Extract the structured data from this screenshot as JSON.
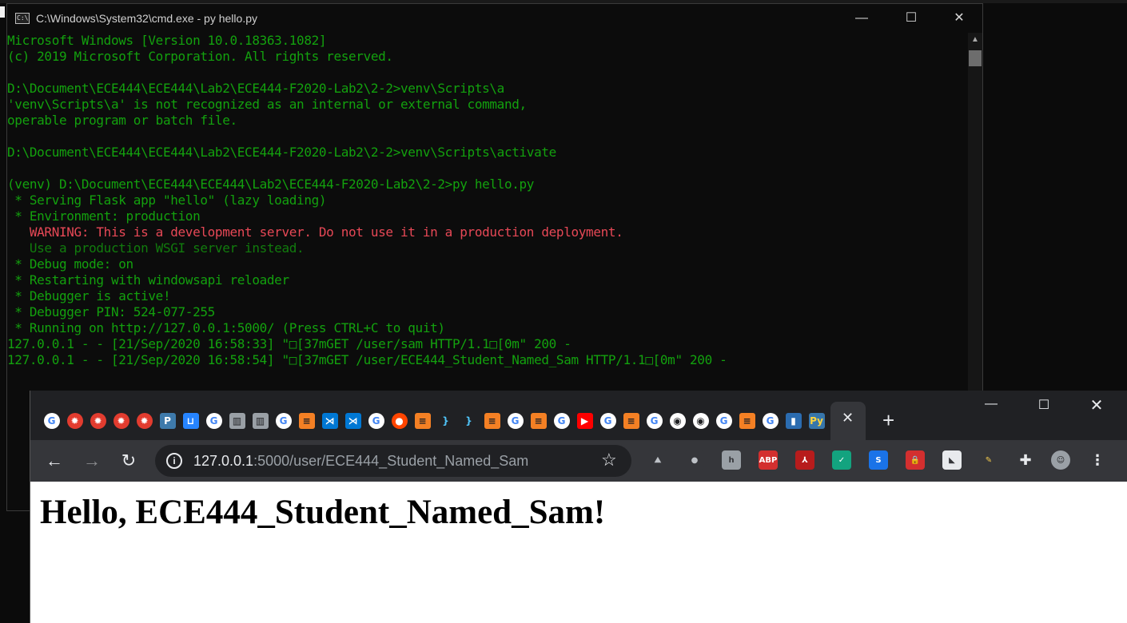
{
  "cmd": {
    "title": "C:\\Windows\\System32\\cmd.exe - py  hello.py",
    "icon_label": "C:\\",
    "lines": [
      {
        "text": "Microsoft Windows [Version 10.0.18363.1082]",
        "style": "normal"
      },
      {
        "text": "(c) 2019 Microsoft Corporation. All rights reserved.",
        "style": "normal"
      },
      {
        "text": "",
        "style": "normal"
      },
      {
        "text": "D:\\Document\\ECE444\\ECE444\\Lab2\\ECE444-F2020-Lab2\\2-2>venv\\Scripts\\a",
        "style": "normal"
      },
      {
        "text": "'venv\\Scripts\\a' is not recognized as an internal or external command,",
        "style": "normal"
      },
      {
        "text": "operable program or batch file.",
        "style": "normal"
      },
      {
        "text": "",
        "style": "normal"
      },
      {
        "text": "D:\\Document\\ECE444\\ECE444\\Lab2\\ECE444-F2020-Lab2\\2-2>venv\\Scripts\\activate",
        "style": "normal"
      },
      {
        "text": "",
        "style": "normal"
      },
      {
        "text": "(venv) D:\\Document\\ECE444\\ECE444\\Lab2\\ECE444-F2020-Lab2\\2-2>py hello.py",
        "style": "normal"
      },
      {
        "text": " * Serving Flask app \"hello\" (lazy loading)",
        "style": "normal"
      },
      {
        "text": " * Environment: production",
        "style": "normal"
      },
      {
        "text": "   WARNING: This is a development server. Do not use it in a production deployment.",
        "style": "warn"
      },
      {
        "text": "   Use a production WSGI server instead.",
        "style": "dim"
      },
      {
        "text": " * Debug mode: on",
        "style": "normal"
      },
      {
        "text": " * Restarting with windowsapi reloader",
        "style": "normal"
      },
      {
        "text": " * Debugger is active!",
        "style": "normal"
      },
      {
        "text": " * Debugger PIN: 524-077-255",
        "style": "normal"
      },
      {
        "text": " * Running on http://127.0.0.1:5000/ (Press CTRL+C to quit)",
        "style": "normal"
      },
      {
        "text": "127.0.0.1 - - [21/Sep/2020 16:58:33] \"□[37mGET /user/sam HTTP/1.1□[0m\" 200 -",
        "style": "normal"
      },
      {
        "text": "127.0.0.1 - - [21/Sep/2020 16:58:54] \"□[37mGET /user/ECE444_Student_Named_Sam HTTP/1.1□[0m\" 200 -",
        "style": "normal"
      }
    ],
    "controls": {
      "minimize": "—",
      "maximize": "☐",
      "close": "✕"
    }
  },
  "chrome": {
    "pinned_tabs": [
      {
        "name": "google",
        "glyph": "G",
        "color": "#ffffff",
        "fg": "#4285f4",
        "shape": "circle"
      },
      {
        "name": "canvas",
        "glyph": "✹",
        "color": "#e23c2f",
        "fg": "#ffffff",
        "shape": "circle"
      },
      {
        "name": "canvas",
        "glyph": "✹",
        "color": "#e23c2f",
        "fg": "#ffffff",
        "shape": "circle"
      },
      {
        "name": "canvas",
        "glyph": "✹",
        "color": "#e23c2f",
        "fg": "#ffffff",
        "shape": "circle"
      },
      {
        "name": "canvas",
        "glyph": "✹",
        "color": "#e23c2f",
        "fg": "#ffffff",
        "shape": "circle"
      },
      {
        "name": "piazza",
        "glyph": "P",
        "color": "#3e7aab",
        "fg": "#ffffff",
        "shape": "square"
      },
      {
        "name": "bitbucket",
        "glyph": "⊔",
        "color": "#2684ff",
        "fg": "#ffffff",
        "shape": "square"
      },
      {
        "name": "google",
        "glyph": "G",
        "color": "#ffffff",
        "fg": "#4285f4",
        "shape": "circle"
      },
      {
        "name": "docs",
        "glyph": "▥",
        "color": "#9aa0a6",
        "fg": "#202124",
        "shape": "square"
      },
      {
        "name": "docs",
        "glyph": "▥",
        "color": "#9aa0a6",
        "fg": "#202124",
        "shape": "square"
      },
      {
        "name": "google",
        "glyph": "G",
        "color": "#ffffff",
        "fg": "#4285f4",
        "shape": "circle"
      },
      {
        "name": "stackoverflow",
        "glyph": "≡",
        "color": "#f48024",
        "fg": "#202124",
        "shape": "square"
      },
      {
        "name": "vscode",
        "glyph": "⋊",
        "color": "#0078d4",
        "fg": "#ffffff",
        "shape": "square"
      },
      {
        "name": "vscode",
        "glyph": "⋊",
        "color": "#0078d4",
        "fg": "#ffffff",
        "shape": "square"
      },
      {
        "name": "google",
        "glyph": "G",
        "color": "#ffffff",
        "fg": "#4285f4",
        "shape": "circle"
      },
      {
        "name": "reddit",
        "glyph": "●",
        "color": "#ff4500",
        "fg": "#ffffff",
        "shape": "circle"
      },
      {
        "name": "stackoverflow",
        "glyph": "≡",
        "color": "#f48024",
        "fg": "#202124",
        "shape": "square"
      },
      {
        "name": "json",
        "glyph": "}",
        "color": "#202124",
        "fg": "#4fc3f7",
        "shape": "square"
      },
      {
        "name": "json",
        "glyph": "}",
        "color": "#202124",
        "fg": "#4fc3f7",
        "shape": "square"
      },
      {
        "name": "stackoverflow",
        "glyph": "≡",
        "color": "#f48024",
        "fg": "#202124",
        "shape": "square"
      },
      {
        "name": "google",
        "glyph": "G",
        "color": "#ffffff",
        "fg": "#4285f4",
        "shape": "circle"
      },
      {
        "name": "stackoverflow",
        "glyph": "≡",
        "color": "#f48024",
        "fg": "#202124",
        "shape": "square"
      },
      {
        "name": "google",
        "glyph": "G",
        "color": "#ffffff",
        "fg": "#4285f4",
        "shape": "circle"
      },
      {
        "name": "youtube",
        "glyph": "▶",
        "color": "#ff0000",
        "fg": "#ffffff",
        "shape": "square"
      },
      {
        "name": "google",
        "glyph": "G",
        "color": "#ffffff",
        "fg": "#4285f4",
        "shape": "circle"
      },
      {
        "name": "stackoverflow",
        "glyph": "≡",
        "color": "#f48024",
        "fg": "#202124",
        "shape": "square"
      },
      {
        "name": "google",
        "glyph": "G",
        "color": "#ffffff",
        "fg": "#4285f4",
        "shape": "circle"
      },
      {
        "name": "github",
        "glyph": "◉",
        "color": "#ffffff",
        "fg": "#202124",
        "shape": "circle"
      },
      {
        "name": "github",
        "glyph": "◉",
        "color": "#ffffff",
        "fg": "#202124",
        "shape": "circle"
      },
      {
        "name": "google",
        "glyph": "G",
        "color": "#ffffff",
        "fg": "#4285f4",
        "shape": "circle"
      },
      {
        "name": "stackoverflow",
        "glyph": "≡",
        "color": "#f48024",
        "fg": "#202124",
        "shape": "square"
      },
      {
        "name": "google",
        "glyph": "G",
        "color": "#ffffff",
        "fg": "#4285f4",
        "shape": "circle"
      },
      {
        "name": "flask-docs",
        "glyph": "▮",
        "color": "#2b6cb0",
        "fg": "#ffffff",
        "shape": "square"
      },
      {
        "name": "python",
        "glyph": "Py",
        "color": "#3776ab",
        "fg": "#ffd43b",
        "shape": "square"
      }
    ],
    "active_tab_close": "✕",
    "new_tab": "+",
    "window_controls": {
      "minimize": "—",
      "maximize": "☐",
      "close": "✕"
    },
    "nav": {
      "back": "←",
      "forward": "→",
      "reload": "↻"
    },
    "info_icon": "i",
    "url_host": "127.0.0.1",
    "url_path": ":5000/user/ECE444_Student_Named_Sam",
    "star": "☆",
    "extensions": [
      {
        "name": "nord-icon",
        "glyph": "⛰",
        "bg": "#35363a",
        "fg": "#bdc1c6"
      },
      {
        "name": "speech-icon",
        "glyph": "●",
        "bg": "#35363a",
        "fg": "#bdc1c6"
      },
      {
        "name": "hypothesis-icon",
        "glyph": "h",
        "bg": "#9aa0a6",
        "fg": "#35363a"
      },
      {
        "name": "abp-icon",
        "glyph": "ABP",
        "bg": "#d32f2f",
        "fg": "#ffffff"
      },
      {
        "name": "pdf-icon",
        "glyph": "⅄",
        "bg": "#b71c1c",
        "fg": "#ffffff"
      },
      {
        "name": "shield-check-icon",
        "glyph": "✓",
        "bg": "#13a37f",
        "fg": "#ffffff"
      },
      {
        "name": "s-icon",
        "glyph": "S",
        "bg": "#1a73e8",
        "fg": "#ffffff"
      },
      {
        "name": "lock-shield-icon",
        "glyph": "🔒",
        "bg": "#d32f2f",
        "fg": "#ffffff"
      },
      {
        "name": "bookmark-icon",
        "glyph": "◣",
        "bg": "#e8eaed",
        "fg": "#35363a"
      },
      {
        "name": "pen-icon",
        "glyph": "✎",
        "bg": "#35363a",
        "fg": "#f2c94c"
      },
      {
        "name": "puzzle-icon",
        "glyph": "✚",
        "bg": "#35363a",
        "fg": "#e8eaed"
      },
      {
        "name": "avatar",
        "glyph": "☺",
        "bg": "#9aa0a6",
        "fg": "#202124"
      },
      {
        "name": "menu-icon",
        "glyph": "⋮",
        "bg": "#35363a",
        "fg": "#e8eaed"
      }
    ],
    "page_heading": "Hello, ECE444_Student_Named_Sam!"
  }
}
